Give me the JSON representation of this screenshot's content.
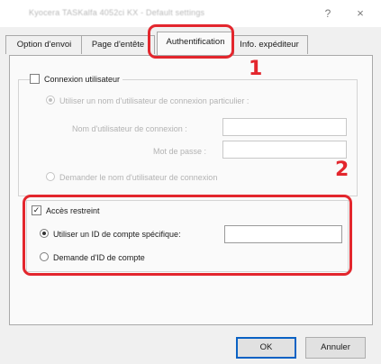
{
  "window": {
    "title": "Kyocera TASKalfa 4052ci KX - Default settings",
    "help_glyph": "?",
    "close_glyph": "×"
  },
  "tabs": [
    {
      "label": "Option d'envoi",
      "active": false
    },
    {
      "label": "Page d'entête",
      "active": false
    },
    {
      "label": "Authentification",
      "active": true
    },
    {
      "label": "Info. expéditeur",
      "active": false
    }
  ],
  "auth": {
    "user_login": {
      "label": "Connexion utilisateur",
      "checked": false,
      "use_specific_label": "Utiliser un nom d'utilisateur de connexion particulier :",
      "login_name_label": "Nom d'utilisateur de connexion :",
      "login_name_value": "",
      "password_label": "Mot de passe :",
      "password_value": "",
      "prompt_label": "Demander le nom d'utilisateur de connexion"
    },
    "job_accounting": {
      "label": "Accès restreint",
      "checked": true,
      "checkmark": "✓",
      "use_specific_label": "Utiliser un ID de compte spécifique:",
      "account_id_value": "",
      "prompt_label": "Demande d'ID de compte"
    }
  },
  "callouts": {
    "marker_1": "1",
    "marker_2": "2"
  },
  "buttons": {
    "ok": "OK",
    "cancel": "Annuler"
  },
  "colors": {
    "highlight": "#e3262d",
    "dialog_bg": "#f0f0f0",
    "disabled_text": "#b3b3b3"
  }
}
